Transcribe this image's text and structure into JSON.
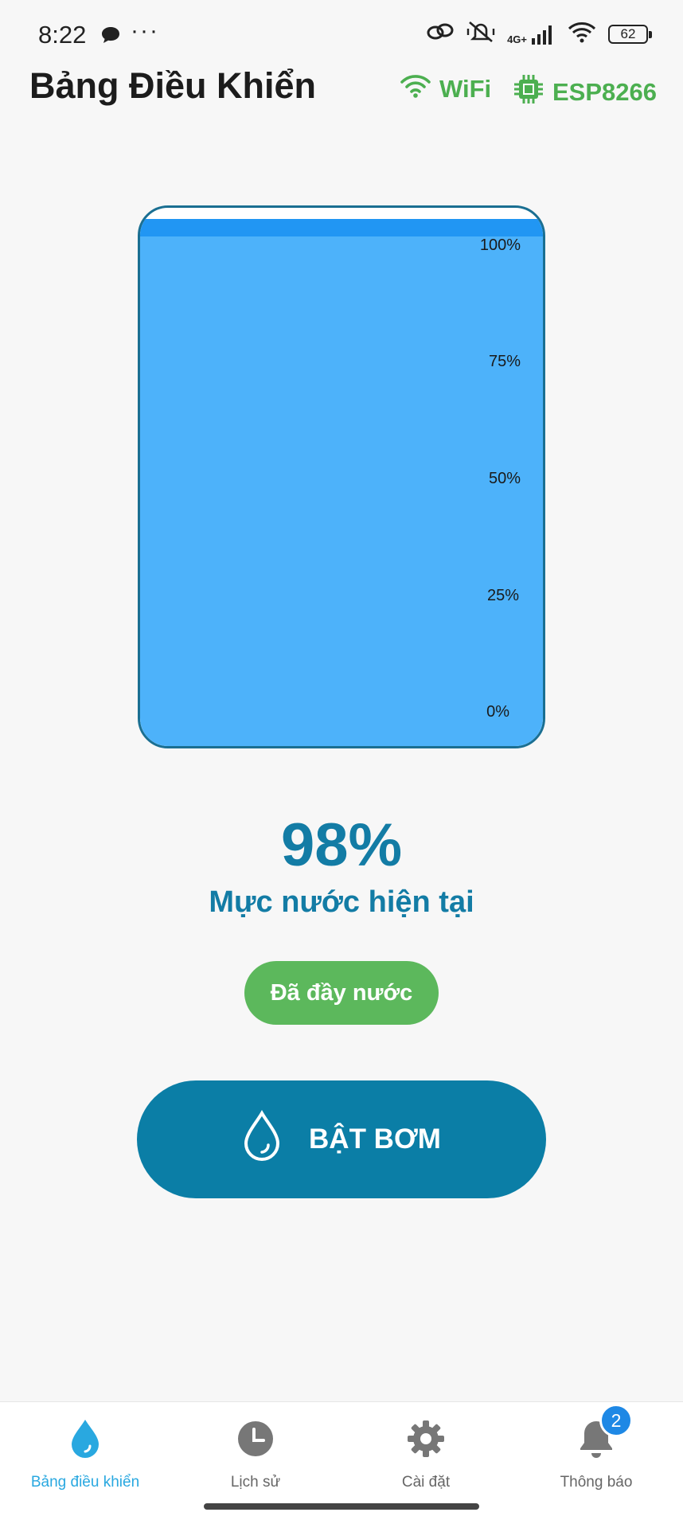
{
  "status_bar": {
    "time": "8:22",
    "more": "···",
    "network": "4G+",
    "battery": "62"
  },
  "header": {
    "title": "Bảng Điều Khiển",
    "wifi_label": "WiFi",
    "device_label": "ESP8266",
    "accent_color": "#4caf50"
  },
  "tank": {
    "fill_percent": 98,
    "ticks": [
      "100%",
      "75%",
      "50%",
      "25%",
      "0%"
    ],
    "water_color": "#4db2fa"
  },
  "readout": {
    "value": "98%",
    "label": "Mực nước hiện tại",
    "status": "Đã đầy nước"
  },
  "pump_button": {
    "label": "BẬT BƠM"
  },
  "nav": {
    "items": [
      {
        "label": "Bảng điều khiển",
        "icon": "water-drop-icon"
      },
      {
        "label": "Lịch sử",
        "icon": "clock-icon"
      },
      {
        "label": "Cài đặt",
        "icon": "gear-icon"
      },
      {
        "label": "Thông báo",
        "icon": "bell-icon"
      }
    ],
    "notification_count": "2"
  }
}
